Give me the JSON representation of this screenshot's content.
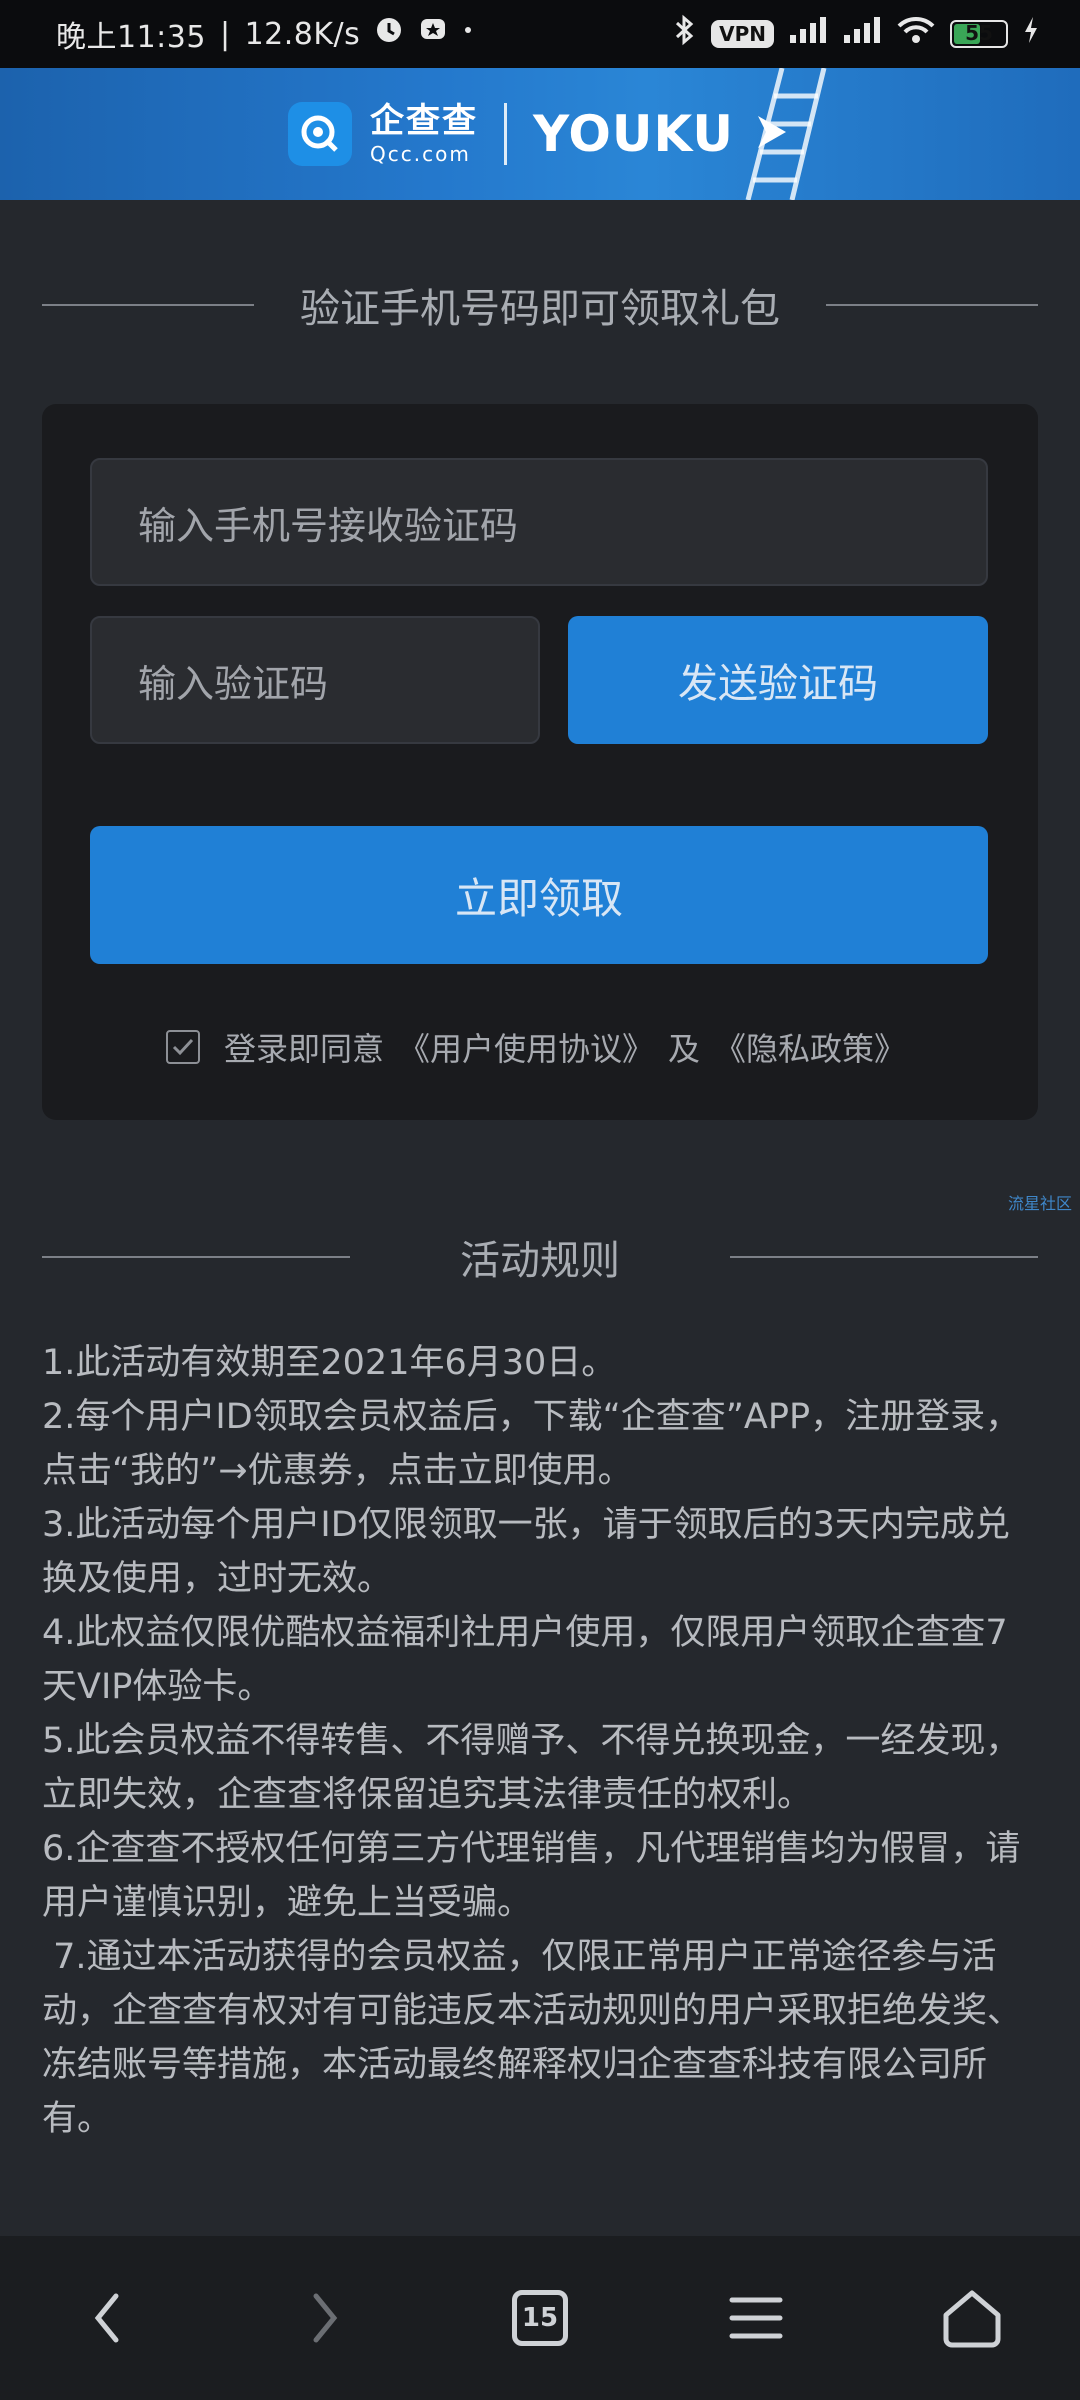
{
  "status_bar": {
    "time": "晚上11:35",
    "speed": "12.8K/s",
    "vpn": "VPN",
    "battery": "55",
    "battery_level": 0.55
  },
  "banner": {
    "qcc_cn": "企查查",
    "qcc_en": "Qcc.com",
    "youku": "YOUKU"
  },
  "form": {
    "heading": "验证手机号码即可领取礼包",
    "phone_placeholder": "输入手机号接收验证码",
    "code_placeholder": "输入验证码",
    "send_button": "发送验证码",
    "claim_button": "立即领取",
    "agree_prefix": "登录即同意",
    "user_agreement": "《用户使用协议》",
    "and": "及",
    "privacy_policy": "《隐私政策》",
    "checked": true
  },
  "watermark": "流星社区",
  "rules": {
    "heading": "活动规则",
    "items": [
      "1.此活动有效期至2021年6月30日。",
      "2.每个用户ID领取会员权益后，下载“企查查”APP，注册登录，点击“我的”→优惠券，点击立即使用。",
      "3.此活动每个用户ID仅限领取一张，请于领取后的3天内完成兑换及使用，过时无效。",
      "4.此权益仅限优酷权益福利社用户使用，仅限用户领取企查查7天VIP体验卡。",
      "5.此会员权益不得转售、不得赠予、不得兑换现金，一经发现，立即失效，企查查将保留追究其法律责任的权利。",
      "6.企查查不授权任何第三方代理销售，凡代理销售均为假冒，请用户谨慎识别，避免上当受骗。",
      " 7.通过本活动获得的会员权益，仅限正常用户正常途径参与活动，企查查有权对有可能违反本活动规则的用户采取拒绝发奖、冻结账号等措施，本活动最终解释权归企查查科技有限公司所有。"
    ]
  },
  "nav": {
    "tab_count": "15"
  }
}
